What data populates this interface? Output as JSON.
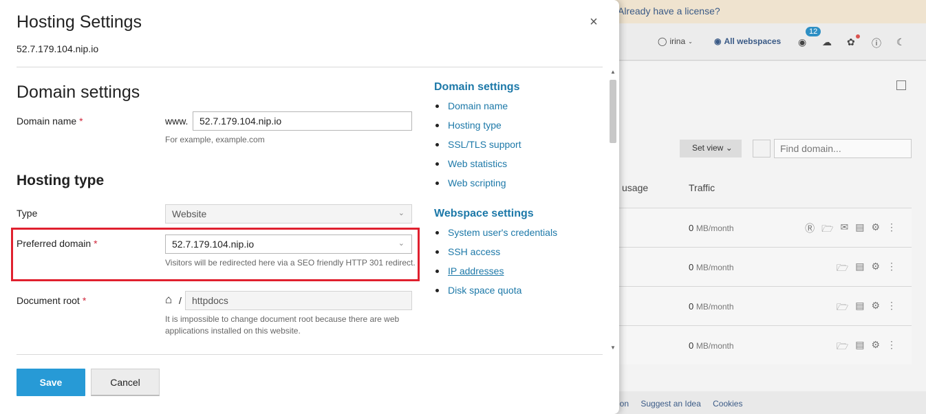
{
  "background": {
    "banner_text": "Already have a license?",
    "user": "irina",
    "webspaces": "All webspaces",
    "notifications_count": "12",
    "set_view": "Set view",
    "find_placeholder": "Find domain...",
    "col_usage": "usage",
    "col_traffic": "Traffic",
    "rows": [
      {
        "traffic_value": "0",
        "traffic_unit": "MB/month"
      },
      {
        "traffic_value": "0",
        "traffic_unit": "MB/month"
      },
      {
        "traffic_value": "0",
        "traffic_unit": "MB/month"
      },
      {
        "traffic_value": "0",
        "traffic_unit": "MB/month"
      }
    ],
    "footer": [
      "ion",
      "Suggest an Idea",
      "Cookies"
    ]
  },
  "modal": {
    "title": "Hosting Settings",
    "subtitle": "52.7.179.104.nip.io",
    "close_symbol": "×",
    "domain_section_title": "Domain settings",
    "domain_name_label": "Domain name",
    "domain_prefix": "www.",
    "domain_name_value": "52.7.179.104.nip.io",
    "domain_hint": "For example, example.com",
    "hosting_section_title": "Hosting type",
    "type_label": "Type",
    "type_value": "Website",
    "preferred_label": "Preferred domain",
    "preferred_value": "52.7.179.104.nip.io",
    "preferred_hint": "Visitors will be redirected here via a SEO friendly HTTP 301 redirect.",
    "docroot_label": "Document root",
    "docroot_sep": "/",
    "docroot_value": "httpdocs",
    "docroot_hint": "It is impossible to change document root because there are web applications installed on this website.",
    "required_mark": "*",
    "save_label": "Save",
    "cancel_label": "Cancel"
  },
  "toc": {
    "domain_heading": "Domain settings",
    "domain_items": [
      "Domain name",
      "Hosting type",
      "SSL/TLS support",
      "Web statistics",
      "Web scripting"
    ],
    "webspace_heading": "Webspace settings",
    "webspace_items": [
      "System user's credentials",
      "SSH access",
      "IP addresses",
      "Disk space quota"
    ]
  },
  "colors": {
    "accent": "#279ad6",
    "link": "#1c78a8",
    "required": "#d0263b",
    "highlight": "#e0202e"
  }
}
